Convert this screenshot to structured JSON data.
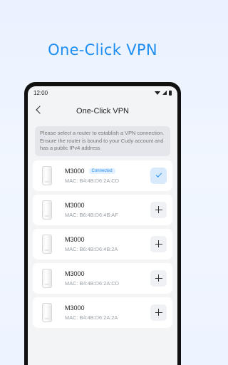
{
  "hero": {
    "title": "One-Click VPN"
  },
  "status": {
    "time": "12:00"
  },
  "nav": {
    "title": "One-Click VPN"
  },
  "notice": {
    "text": "Please select a router to establish a VPN connection. Ensure the router is bound to your Cudy account and has a public IPv4 address"
  },
  "routers": [
    {
      "name": "M3000",
      "badge": "Connected",
      "mac": "MAC: B4:4B:D6:2A:CD",
      "action": "check-icon"
    },
    {
      "name": "M3000",
      "badge": "",
      "mac": "MAC: B6:4B:D6:4B:AF",
      "action": "plus-icon"
    },
    {
      "name": "M3000",
      "badge": "",
      "mac": "MAC: B6:4B:D6:4B:2A",
      "action": "plus-icon"
    },
    {
      "name": "M3000",
      "badge": "",
      "mac": "MAC: B4:4B:D6:2A:CD",
      "action": "plus-icon"
    },
    {
      "name": "M3000",
      "badge": "",
      "mac": "MAC: B4:4B:D6:2A:2A",
      "action": "plus-icon"
    }
  ],
  "colors": {
    "accent": "#1f8ef1",
    "badge_bg": "#e3f0ff"
  }
}
